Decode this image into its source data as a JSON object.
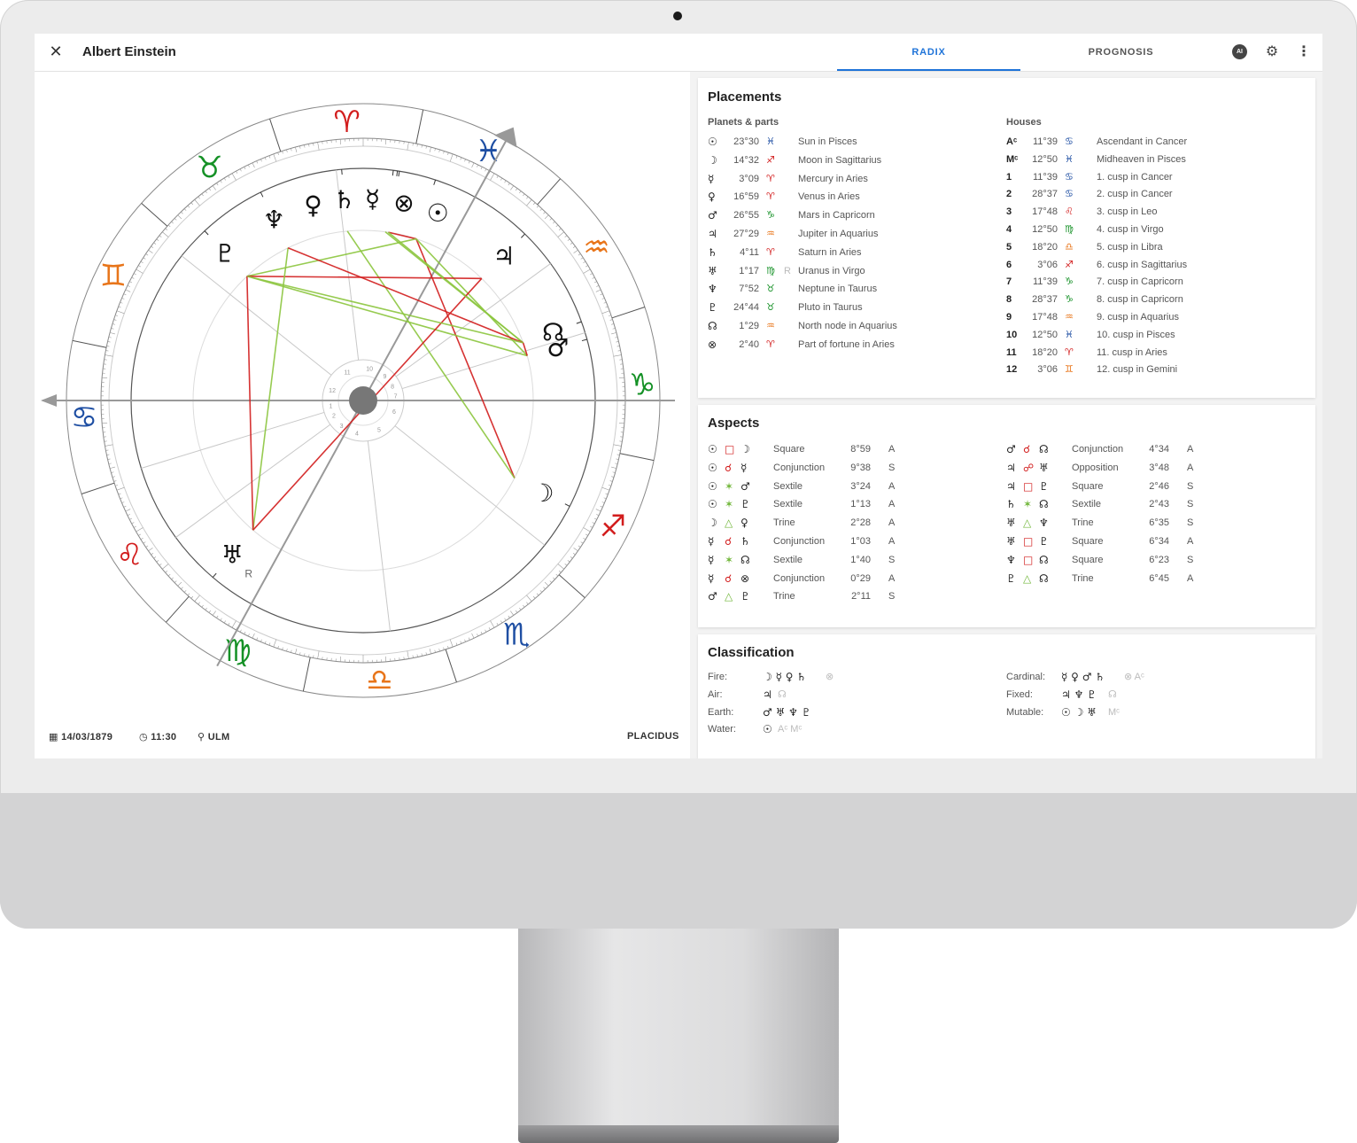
{
  "app": {
    "title": "Albert Einstein",
    "tabs": [
      "RADIX",
      "PROGNOSIS"
    ],
    "active_tab": "RADIX",
    "ai_label": "AI",
    "accent_color": "#1e73d8"
  },
  "chart_footer": {
    "date": "14/03/1879",
    "time": "11:30",
    "place": "ULM",
    "house_system": "PLACIDUS"
  },
  "wheel": {
    "signs": [
      {
        "glyph": "♈",
        "color": "#d21d1d"
      },
      {
        "glyph": "♉",
        "color": "#159126"
      },
      {
        "glyph": "♊",
        "color": "#e8751a"
      },
      {
        "glyph": "♋",
        "color": "#1f4fa3"
      },
      {
        "glyph": "♌",
        "color": "#d21d1d"
      },
      {
        "glyph": "♍",
        "color": "#159126"
      },
      {
        "glyph": "♎",
        "color": "#e8751a"
      },
      {
        "glyph": "♏",
        "color": "#1f4fa3"
      },
      {
        "glyph": "♐",
        "color": "#d21d1d"
      },
      {
        "glyph": "♑",
        "color": "#159126"
      },
      {
        "glyph": "♒",
        "color": "#e8751a"
      },
      {
        "glyph": "♓",
        "color": "#1f4fa3"
      }
    ],
    "planets": [
      {
        "glyph": "♀"
      },
      {
        "glyph": "♄"
      },
      {
        "glyph": "☿"
      },
      {
        "glyph": "⊗"
      },
      {
        "glyph": "☉"
      },
      {
        "glyph": "♆"
      },
      {
        "glyph": "♇"
      },
      {
        "glyph": "♃"
      },
      {
        "glyph": "☊"
      },
      {
        "glyph": "♂"
      },
      {
        "glyph": "☽"
      },
      {
        "glyph": "♅",
        "retro": "R"
      }
    ],
    "house_numbers": [
      "1",
      "2",
      "3",
      "4",
      "5",
      "6",
      "7",
      "8",
      "9",
      "10",
      "11",
      "12"
    ]
  },
  "placements": {
    "title": "Placements",
    "planets_header": "Planets & parts",
    "houses_header": "Houses",
    "planets": [
      {
        "glyph": "☉",
        "deg": "23°30",
        "sign": "♓",
        "color": "#1f4fa3",
        "label": "Sun in Pisces"
      },
      {
        "glyph": "☽",
        "deg": "14°32",
        "sign": "♐",
        "color": "#d21d1d",
        "label": "Moon in Sagittarius"
      },
      {
        "glyph": "☿",
        "deg": "3°09",
        "sign": "♈",
        "color": "#d21d1d",
        "label": "Mercury in Aries"
      },
      {
        "glyph": "♀",
        "deg": "16°59",
        "sign": "♈",
        "color": "#d21d1d",
        "label": "Venus in Aries"
      },
      {
        "glyph": "♂",
        "deg": "26°55",
        "sign": "♑",
        "color": "#159126",
        "label": "Mars in Capricorn"
      },
      {
        "glyph": "♃",
        "deg": "27°29",
        "sign": "♒",
        "color": "#e8751a",
        "label": "Jupiter in Aquarius"
      },
      {
        "glyph": "♄",
        "deg": "4°11",
        "sign": "♈",
        "color": "#d21d1d",
        "label": "Saturn in Aries"
      },
      {
        "glyph": "♅",
        "deg": "1°17",
        "sign": "♍",
        "color": "#159126",
        "retro": "R",
        "label": "Uranus in Virgo"
      },
      {
        "glyph": "♆",
        "deg": "7°52",
        "sign": "♉",
        "color": "#159126",
        "label": "Neptune in Taurus"
      },
      {
        "glyph": "♇",
        "deg": "24°44",
        "sign": "♉",
        "color": "#159126",
        "label": "Pluto in Taurus"
      },
      {
        "glyph": "☊",
        "deg": "1°29",
        "sign": "♒",
        "color": "#e8751a",
        "label": "North node in Aquarius"
      },
      {
        "glyph": "⊗",
        "deg": "2°40",
        "sign": "♈",
        "color": "#d21d1d",
        "label": "Part of fortune in Aries"
      }
    ],
    "houses": [
      {
        "num": "Aᶜ",
        "deg": "11°39",
        "sign": "♋",
        "color": "#1f4fa3",
        "label": "Ascendant in Cancer"
      },
      {
        "num": "Mᶜ",
        "deg": "12°50",
        "sign": "♓",
        "color": "#1f4fa3",
        "label": "Midheaven in Pisces"
      },
      {
        "num": "1",
        "deg": "11°39",
        "sign": "♋",
        "color": "#1f4fa3",
        "label": "1. cusp in Cancer"
      },
      {
        "num": "2",
        "deg": "28°37",
        "sign": "♋",
        "color": "#1f4fa3",
        "label": "2. cusp in Cancer"
      },
      {
        "num": "3",
        "deg": "17°48",
        "sign": "♌",
        "color": "#d21d1d",
        "label": "3. cusp in Leo"
      },
      {
        "num": "4",
        "deg": "12°50",
        "sign": "♍",
        "color": "#159126",
        "label": "4. cusp in Virgo"
      },
      {
        "num": "5",
        "deg": "18°20",
        "sign": "♎",
        "color": "#e8751a",
        "label": "5. cusp in Libra"
      },
      {
        "num": "6",
        "deg": "3°06",
        "sign": "♐",
        "color": "#d21d1d",
        "label": "6. cusp in Sagittarius"
      },
      {
        "num": "7",
        "deg": "11°39",
        "sign": "♑",
        "color": "#159126",
        "label": "7. cusp in Capricorn"
      },
      {
        "num": "8",
        "deg": "28°37",
        "sign": "♑",
        "color": "#159126",
        "label": "8. cusp in Capricorn"
      },
      {
        "num": "9",
        "deg": "17°48",
        "sign": "♒",
        "color": "#e8751a",
        "label": "9. cusp in Aquarius"
      },
      {
        "num": "10",
        "deg": "12°50",
        "sign": "♓",
        "color": "#1f4fa3",
        "label": "10. cusp in Pisces"
      },
      {
        "num": "11",
        "deg": "18°20",
        "sign": "♈",
        "color": "#d21d1d",
        "label": "11. cusp in Aries"
      },
      {
        "num": "12",
        "deg": "3°06",
        "sign": "♊",
        "color": "#e8751a",
        "label": "12. cusp in Gemini"
      }
    ]
  },
  "aspects": {
    "title": "Aspects",
    "left": [
      {
        "a": "☉",
        "asp": "□",
        "acolor": "#d21d1d",
        "b": "☽",
        "name": "Square",
        "orb": "8°59",
        "flag": "A"
      },
      {
        "a": "☉",
        "asp": "☌",
        "acolor": "#d21d1d",
        "b": "☿",
        "name": "Conjunction",
        "orb": "9°38",
        "flag": "S"
      },
      {
        "a": "☉",
        "asp": "✶",
        "acolor": "#72b73b",
        "b": "♂",
        "name": "Sextile",
        "orb": "3°24",
        "flag": "A"
      },
      {
        "a": "☉",
        "asp": "✶",
        "acolor": "#72b73b",
        "b": "♇",
        "name": "Sextile",
        "orb": "1°13",
        "flag": "A"
      },
      {
        "a": "☽",
        "asp": "△",
        "acolor": "#72b73b",
        "b": "♀",
        "name": "Trine",
        "orb": "2°28",
        "flag": "A"
      },
      {
        "a": "☿",
        "asp": "☌",
        "acolor": "#d21d1d",
        "b": "♄",
        "name": "Conjunction",
        "orb": "1°03",
        "flag": "A"
      },
      {
        "a": "☿",
        "asp": "✶",
        "acolor": "#72b73b",
        "b": "☊",
        "name": "Sextile",
        "orb": "1°40",
        "flag": "S"
      },
      {
        "a": "☿",
        "asp": "☌",
        "acolor": "#d21d1d",
        "b": "⊗",
        "name": "Conjunction",
        "orb": "0°29",
        "flag": "A"
      },
      {
        "a": "♂",
        "asp": "△",
        "acolor": "#72b73b",
        "b": "♇",
        "name": "Trine",
        "orb": "2°11",
        "flag": "S"
      }
    ],
    "right": [
      {
        "a": "♂",
        "asp": "☌",
        "acolor": "#d21d1d",
        "b": "☊",
        "name": "Conjunction",
        "orb": "4°34",
        "flag": "A"
      },
      {
        "a": "♃",
        "asp": "☍",
        "acolor": "#d21d1d",
        "b": "♅",
        "name": "Opposition",
        "orb": "3°48",
        "flag": "A"
      },
      {
        "a": "♃",
        "asp": "□",
        "acolor": "#d21d1d",
        "b": "♇",
        "name": "Square",
        "orb": "2°46",
        "flag": "S"
      },
      {
        "a": "♄",
        "asp": "✶",
        "acolor": "#72b73b",
        "b": "☊",
        "name": "Sextile",
        "orb": "2°43",
        "flag": "S"
      },
      {
        "a": "♅",
        "asp": "△",
        "acolor": "#72b73b",
        "b": "♆",
        "name": "Trine",
        "orb": "6°35",
        "flag": "S"
      },
      {
        "a": "♅",
        "asp": "□",
        "acolor": "#d21d1d",
        "b": "♇",
        "name": "Square",
        "orb": "6°34",
        "flag": "A"
      },
      {
        "a": "♆",
        "asp": "□",
        "acolor": "#d21d1d",
        "b": "☊",
        "name": "Square",
        "orb": "6°23",
        "flag": "S"
      },
      {
        "a": "♇",
        "asp": "△",
        "acolor": "#72b73b",
        "b": "☊",
        "name": "Trine",
        "orb": "6°45",
        "flag": "A"
      }
    ]
  },
  "classification": {
    "title": "Classification",
    "left": [
      {
        "label": "Fire:",
        "glyphs": "☽ ☿ ♀ ♄",
        "muted": "⊗"
      },
      {
        "label": "Air:",
        "glyphs": "♃",
        "muted": "☊"
      },
      {
        "label": "Earth:",
        "glyphs": "♂ ♅ ♆ ♇",
        "muted": ""
      },
      {
        "label": "Water:",
        "glyphs": "☉",
        "muted": "Aᶜ Mᶜ"
      }
    ],
    "right": [
      {
        "label": "Cardinal:",
        "glyphs": "☿ ♀ ♂ ♄",
        "muted": "⊗ Aᶜ"
      },
      {
        "label": "Fixed:",
        "glyphs": "♃ ♆ ♇",
        "muted": "☊"
      },
      {
        "label": "Mutable:",
        "glyphs": "☉ ☽ ♅",
        "muted": "Mᶜ"
      }
    ]
  }
}
